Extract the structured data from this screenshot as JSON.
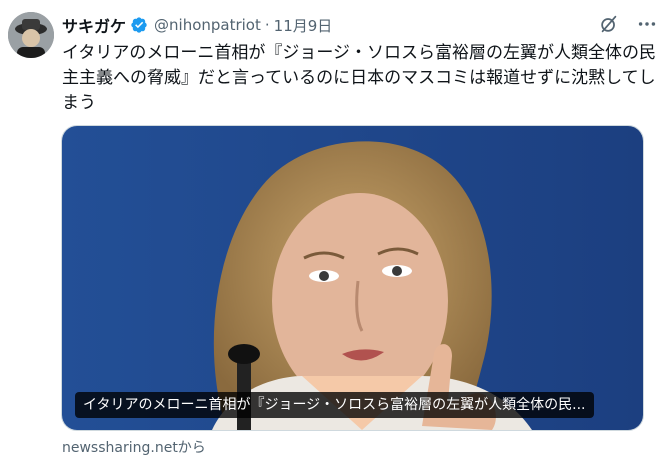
{
  "author": {
    "display_name": "サキガケ",
    "handle": "@nihonpatriot",
    "separator": "·",
    "date": "11月9日"
  },
  "tweet": {
    "text": "イタリアのメローニ首相が『ジョージ・ソロスら富裕層の左翼が人類全体の民主主義への脅威』だと言っているのに日本のマスコミは報道せずに沈黙してしまう"
  },
  "card": {
    "caption": "イタリアのメローニ首相が『ジョージ・ソロスら富裕層の左翼が人類全体の民...",
    "source": "newssharing.netから"
  },
  "icons": {
    "verified": "verified-badge-icon",
    "grok": "grok-icon",
    "more": "more-icon"
  },
  "colors": {
    "verified": "#1d9bf0",
    "secondary_text": "#536471",
    "card_background": "#1f4a8f"
  }
}
